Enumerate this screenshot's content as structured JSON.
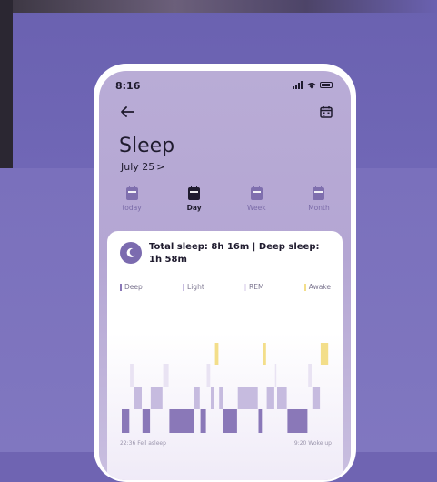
{
  "status": {
    "time": "8:16"
  },
  "header": {
    "title": "Sleep",
    "date": "July 25",
    "date_chevron": ">"
  },
  "icons": {
    "back": "arrow-left-icon",
    "calendar": "calendar-icon",
    "moon": "moon-icon"
  },
  "tabs": [
    {
      "label": "today",
      "active": false
    },
    {
      "label": "Day",
      "active": true
    },
    {
      "label": "Week",
      "active": false
    },
    {
      "label": "Month",
      "active": false
    }
  ],
  "summary": {
    "text": "Total sleep: 8h 16m | Deep sleep: 1h 58m"
  },
  "legend": [
    {
      "label": "Deep",
      "color": "#8a78b8"
    },
    {
      "label": "Light",
      "color": "#c6bbdf"
    },
    {
      "label": "REM",
      "color": "#e9e3f3"
    },
    {
      "label": "Awake",
      "color": "#f3de8a"
    }
  ],
  "chart_labels": {
    "start": "22:36 Fell asleep",
    "end": "9:20 Woke up"
  },
  "colors": {
    "background": "#6f64b2",
    "screen": "#b9acd6",
    "deep": "#8a78b8",
    "light": "#c6bbdf",
    "rem": "#e9e3f3",
    "awake": "#f3de8a",
    "text": "#1f1b2e"
  },
  "chart_data": {
    "type": "bar",
    "x_start": "22:36",
    "x_end": "9:20",
    "stages": [
      "Deep",
      "Light",
      "REM",
      "Awake"
    ],
    "segments": [
      {
        "stage": "Deep",
        "start": 0.0,
        "end": 0.04
      },
      {
        "stage": "REM",
        "start": 0.04,
        "end": 0.06
      },
      {
        "stage": "Light",
        "start": 0.06,
        "end": 0.1
      },
      {
        "stage": "Deep",
        "start": 0.1,
        "end": 0.14
      },
      {
        "stage": "Light",
        "start": 0.14,
        "end": 0.2
      },
      {
        "stage": "REM",
        "start": 0.2,
        "end": 0.23
      },
      {
        "stage": "Deep",
        "start": 0.23,
        "end": 0.35
      },
      {
        "stage": "Light",
        "start": 0.35,
        "end": 0.38
      },
      {
        "stage": "Deep",
        "start": 0.38,
        "end": 0.41
      },
      {
        "stage": "REM",
        "start": 0.41,
        "end": 0.43
      },
      {
        "stage": "Light",
        "start": 0.43,
        "end": 0.45
      },
      {
        "stage": "Awake",
        "start": 0.45,
        "end": 0.47
      },
      {
        "stage": "Light",
        "start": 0.47,
        "end": 0.49
      },
      {
        "stage": "Deep",
        "start": 0.49,
        "end": 0.56
      },
      {
        "stage": "Light",
        "start": 0.56,
        "end": 0.66
      },
      {
        "stage": "Deep",
        "start": 0.66,
        "end": 0.68
      },
      {
        "stage": "Awake",
        "start": 0.68,
        "end": 0.7
      },
      {
        "stage": "Light",
        "start": 0.7,
        "end": 0.74
      },
      {
        "stage": "REM",
        "start": 0.74,
        "end": 0.75
      },
      {
        "stage": "Light",
        "start": 0.75,
        "end": 0.8
      },
      {
        "stage": "Deep",
        "start": 0.8,
        "end": 0.9
      },
      {
        "stage": "REM",
        "start": 0.9,
        "end": 0.92
      },
      {
        "stage": "Light",
        "start": 0.92,
        "end": 0.96
      },
      {
        "stage": "Awake",
        "start": 0.96,
        "end": 1.0
      }
    ]
  }
}
